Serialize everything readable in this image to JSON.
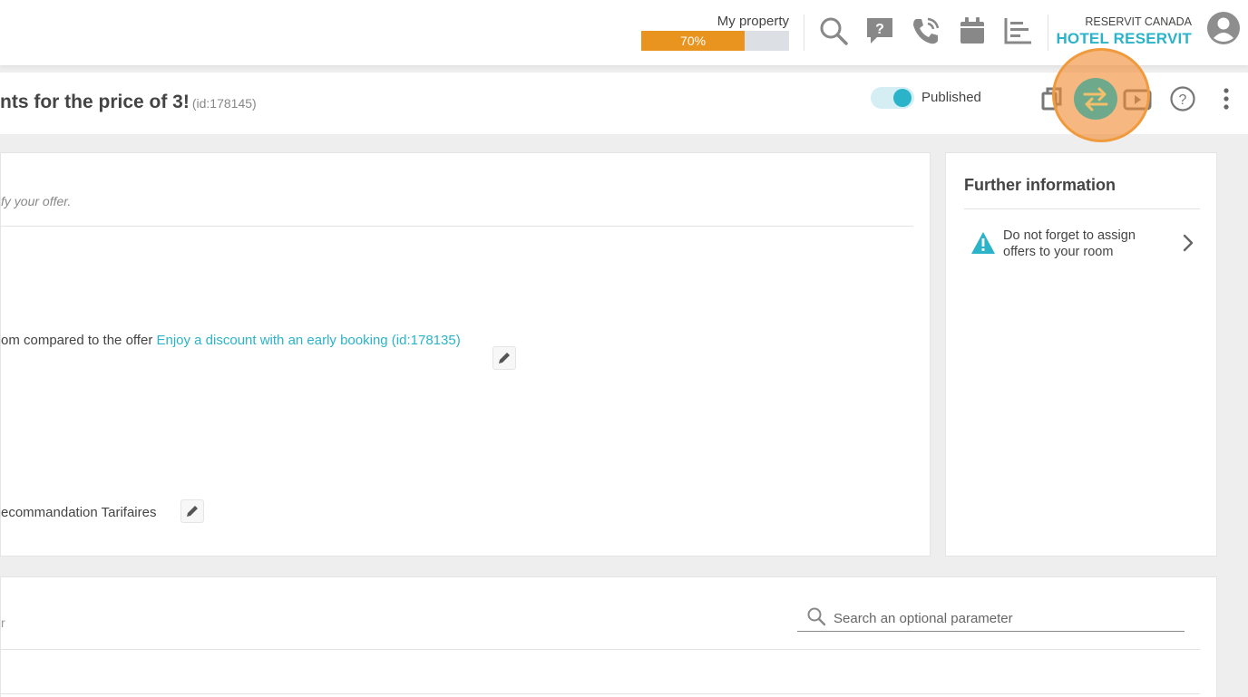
{
  "header": {
    "property_label": "My property",
    "progress_percent": 70,
    "progress_text": "70%",
    "company": "RESERVIT CANADA",
    "hotel": "HOTEL RESERVIT",
    "icons": [
      "search-icon",
      "help-chat-icon",
      "phone-icon",
      "calendar-icon",
      "statistics-icon",
      "user-avatar-icon"
    ]
  },
  "offer": {
    "title": "nts for the price of 3!",
    "id_text": "(id:178145)",
    "status_label": "Published",
    "status_on": true,
    "actions": [
      "duplicate-icon",
      "swap-icon",
      "video-icon",
      "help-icon",
      "more-icon"
    ]
  },
  "main_card": {
    "hint": "fy your offer.",
    "line1_prefix": "om compared to the offer ",
    "line1_link": "Enjoy a discount with an early booking (id:178135)",
    "line2": "ecommandation Tarifaires"
  },
  "side_card": {
    "title": "Further information",
    "item_text": "Do not forget to assign offers to your room"
  },
  "bottom_card": {
    "fragment": "r",
    "search_placeholder": "Search an optional parameter"
  },
  "colors": {
    "accent": "#2bb3c9",
    "progress": "#e8941f",
    "highlight": "#f09a3e"
  }
}
